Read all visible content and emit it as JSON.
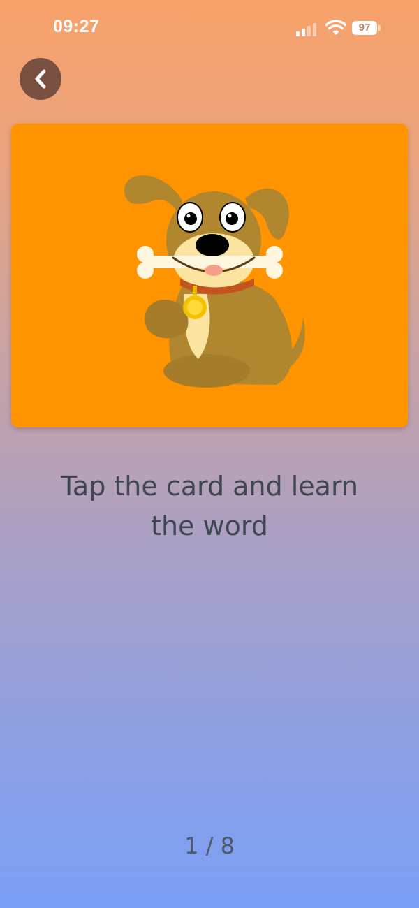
{
  "status_bar": {
    "time": "09:27",
    "battery_level": "97",
    "icons": [
      "cellular-signal-icon",
      "wifi-icon",
      "battery-icon"
    ]
  },
  "nav": {
    "back_icon": "chevron-left-icon"
  },
  "card": {
    "image": "cartoon dog holding bone illustration",
    "background_color": "#ff9300"
  },
  "instruction": "Tap the card and learn the word",
  "progress": {
    "label": "1 / 8",
    "current": 1,
    "total": 8
  },
  "colors": {
    "gradient_top": "#f7a16a",
    "gradient_bottom": "#7a9ff6",
    "text": "#3e4752"
  }
}
